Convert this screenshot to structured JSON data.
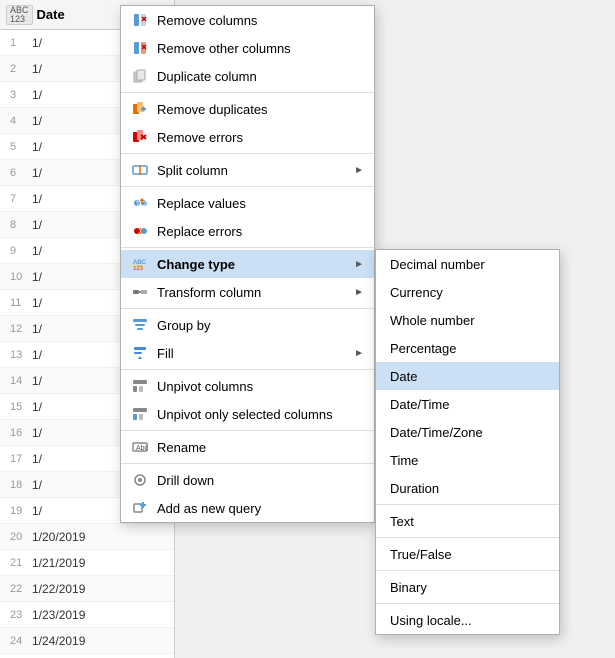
{
  "table": {
    "column_header": "Date",
    "column_type": "ABC\n123",
    "rows": [
      {
        "num": 1,
        "value": "1/",
        "highlighted": false
      },
      {
        "num": 2,
        "value": "1/",
        "highlighted": false
      },
      {
        "num": 3,
        "value": "1/",
        "highlighted": false
      },
      {
        "num": 4,
        "value": "1/",
        "highlighted": false
      },
      {
        "num": 5,
        "value": "1/",
        "highlighted": false
      },
      {
        "num": 6,
        "value": "1/",
        "highlighted": false
      },
      {
        "num": 7,
        "value": "1/",
        "highlighted": false
      },
      {
        "num": 8,
        "value": "1/",
        "highlighted": false
      },
      {
        "num": 9,
        "value": "1/",
        "highlighted": false
      },
      {
        "num": 10,
        "value": "1/",
        "highlighted": false
      },
      {
        "num": 11,
        "value": "1/",
        "highlighted": false
      },
      {
        "num": 12,
        "value": "1/",
        "highlighted": false
      },
      {
        "num": 13,
        "value": "1/",
        "highlighted": false
      },
      {
        "num": 14,
        "value": "1/",
        "highlighted": false
      },
      {
        "num": 15,
        "value": "1/",
        "highlighted": false
      },
      {
        "num": 16,
        "value": "1/",
        "highlighted": false
      },
      {
        "num": 17,
        "value": "1/",
        "highlighted": false
      },
      {
        "num": 18,
        "value": "1/",
        "highlighted": false
      },
      {
        "num": 19,
        "value": "1/",
        "highlighted": false
      },
      {
        "num": 20,
        "value": "1/20/2019",
        "highlighted": false
      },
      {
        "num": 21,
        "value": "1/21/2019",
        "highlighted": false
      },
      {
        "num": 22,
        "value": "1/22/2019",
        "highlighted": false
      },
      {
        "num": 23,
        "value": "1/23/2019",
        "highlighted": false
      },
      {
        "num": 24,
        "value": "1/24/2019",
        "highlighted": false
      }
    ]
  },
  "context_menu": {
    "items": [
      {
        "id": "remove-columns",
        "label": "Remove columns",
        "has_arrow": false,
        "icon": "remove-col-icon"
      },
      {
        "id": "remove-other-columns",
        "label": "Remove other columns",
        "has_arrow": false,
        "icon": "remove-other-icon"
      },
      {
        "id": "duplicate-column",
        "label": "Duplicate column",
        "has_arrow": false,
        "icon": "duplicate-icon"
      },
      {
        "id": "divider1",
        "type": "divider"
      },
      {
        "id": "remove-duplicates",
        "label": "Remove duplicates",
        "has_arrow": false,
        "icon": "remove-dup-icon"
      },
      {
        "id": "remove-errors",
        "label": "Remove errors",
        "has_arrow": false,
        "icon": "remove-err-icon"
      },
      {
        "id": "divider2",
        "type": "divider"
      },
      {
        "id": "split-column",
        "label": "Split column",
        "has_arrow": true,
        "icon": "split-icon"
      },
      {
        "id": "divider3",
        "type": "divider"
      },
      {
        "id": "replace-values",
        "label": "Replace values",
        "has_arrow": false,
        "icon": "replace-val-icon"
      },
      {
        "id": "replace-errors",
        "label": "Replace errors",
        "has_arrow": false,
        "icon": "replace-err-icon"
      },
      {
        "id": "divider4",
        "type": "divider"
      },
      {
        "id": "change-type",
        "label": "Change type",
        "has_arrow": true,
        "icon": "change-type-icon",
        "active": true
      },
      {
        "id": "transform-column",
        "label": "Transform column",
        "has_arrow": true,
        "icon": "transform-icon"
      },
      {
        "id": "divider5",
        "type": "divider"
      },
      {
        "id": "group-by",
        "label": "Group by",
        "has_arrow": false,
        "icon": "group-by-icon"
      },
      {
        "id": "fill",
        "label": "Fill",
        "has_arrow": true,
        "icon": "fill-icon"
      },
      {
        "id": "divider6",
        "type": "divider"
      },
      {
        "id": "unpivot-columns",
        "label": "Unpivot columns",
        "has_arrow": false,
        "icon": "unpivot-icon"
      },
      {
        "id": "unpivot-only",
        "label": "Unpivot only selected columns",
        "has_arrow": false,
        "icon": "unpivot-sel-icon"
      },
      {
        "id": "divider7",
        "type": "divider"
      },
      {
        "id": "rename",
        "label": "Rename",
        "has_arrow": false,
        "icon": "rename-icon"
      },
      {
        "id": "divider8",
        "type": "divider"
      },
      {
        "id": "drill-down",
        "label": "Drill down",
        "has_arrow": false,
        "icon": "drill-icon"
      },
      {
        "id": "add-as-new-query",
        "label": "Add as new query",
        "has_arrow": false,
        "icon": "add-query-icon"
      }
    ]
  },
  "submenu": {
    "title": "Change type",
    "items": [
      {
        "id": "decimal-number",
        "label": "Decimal number"
      },
      {
        "id": "currency",
        "label": "Currency"
      },
      {
        "id": "whole-number",
        "label": "Whole number"
      },
      {
        "id": "percentage",
        "label": "Percentage"
      },
      {
        "id": "date",
        "label": "Date",
        "highlighted": true
      },
      {
        "id": "datetime",
        "label": "Date/Time"
      },
      {
        "id": "datetimezone",
        "label": "Date/Time/Zone"
      },
      {
        "id": "time",
        "label": "Time"
      },
      {
        "id": "duration",
        "label": "Duration"
      },
      {
        "id": "divider1",
        "type": "divider"
      },
      {
        "id": "text",
        "label": "Text"
      },
      {
        "id": "divider2",
        "type": "divider"
      },
      {
        "id": "true-false",
        "label": "True/False"
      },
      {
        "id": "divider3",
        "type": "divider"
      },
      {
        "id": "binary",
        "label": "Binary"
      },
      {
        "id": "divider4",
        "type": "divider"
      },
      {
        "id": "using-locale",
        "label": "Using locale..."
      }
    ]
  }
}
